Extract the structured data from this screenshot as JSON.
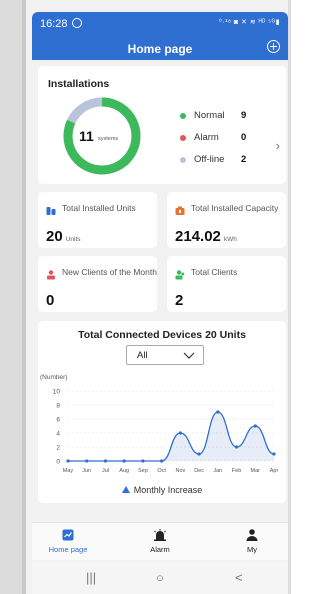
{
  "status": {
    "time": "16:28",
    "icons": "⁰·¹⁸ ◙ ✕ ≋ ᴴᴰ ⁵ᴳ▮"
  },
  "header": {
    "title": "Home page"
  },
  "installations": {
    "title": "Installations",
    "total_value": "11",
    "total_unit": "systems",
    "legend": [
      {
        "label": "Normal",
        "count": "9",
        "color": "#3cb95a"
      },
      {
        "label": "Alarm",
        "count": "0",
        "color": "#e05555"
      },
      {
        "label": "Off-line",
        "count": "2",
        "color": "#b9c4dc"
      }
    ],
    "fractions": {
      "normal": 0.818,
      "alarm": 0,
      "offline": 0.182
    }
  },
  "stats": {
    "units": {
      "label": "Total Installed Units",
      "value": "20",
      "unit": "Units"
    },
    "capacity": {
      "label": "Total Installed Capacity",
      "value": "214.02",
      "unit": "kWh"
    },
    "new_clients": {
      "label": "New Clients of the Month",
      "value": "0"
    },
    "total_clients": {
      "label": "Total Clients",
      "value": "2"
    }
  },
  "devices": {
    "title": "Total Connected Devices 20 Units",
    "filter_value": "All"
  },
  "chart_data": {
    "type": "line",
    "title": "Total Connected Devices 20 Units",
    "ylabel": "(Number)",
    "categories": [
      "May",
      "Jun",
      "Jul",
      "Aug",
      "Sep",
      "Oct",
      "Nov",
      "Dec",
      "Jan",
      "Feb",
      "Mar",
      "Apr"
    ],
    "yticks": [
      0,
      2,
      4,
      6,
      8,
      10
    ],
    "ylim": [
      0,
      10
    ],
    "series": [
      {
        "name": "Monthly Increase",
        "values": [
          0,
          0,
          0,
          0,
          0,
          0,
          4,
          1,
          7,
          2,
          5,
          1
        ]
      }
    ],
    "legend_position": "bottom",
    "grid": true,
    "color": "#2f6fd1"
  },
  "tabs": [
    {
      "label": "Home page",
      "icon": "chart-icon",
      "active": true
    },
    {
      "label": "Alarm",
      "icon": "alarm-icon",
      "active": false
    },
    {
      "label": "My",
      "icon": "person-icon",
      "active": false
    }
  ],
  "navbar": {
    "recent": "|||",
    "home": "○",
    "back": "<"
  }
}
